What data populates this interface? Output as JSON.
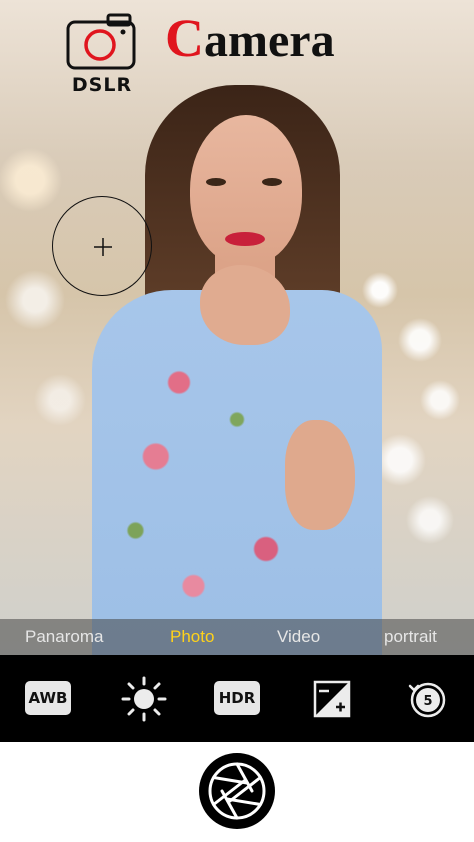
{
  "app": {
    "logo_text": "DSLR",
    "title_first_letter": "C",
    "title_rest": "amera"
  },
  "colors": {
    "title_accent": "#e0151e",
    "active_mode": "#ffd21a",
    "control_bar_bg": "#000000",
    "logo_lens": "#e0151e"
  },
  "focus": {
    "icon": "crosshair-icon"
  },
  "modes": {
    "panorama": "Panaroma",
    "photo": "Photo",
    "video": "Video",
    "portrait": "portrait",
    "active": "Photo"
  },
  "controls": {
    "awb": "AWB",
    "exposure_icon": "brightness-icon",
    "hdr": "HDR",
    "ev_icon": "exposure-compensation-icon",
    "timer_icon": "timer-5s-icon"
  },
  "shutter": {
    "icon": "aperture-shutter-icon"
  }
}
